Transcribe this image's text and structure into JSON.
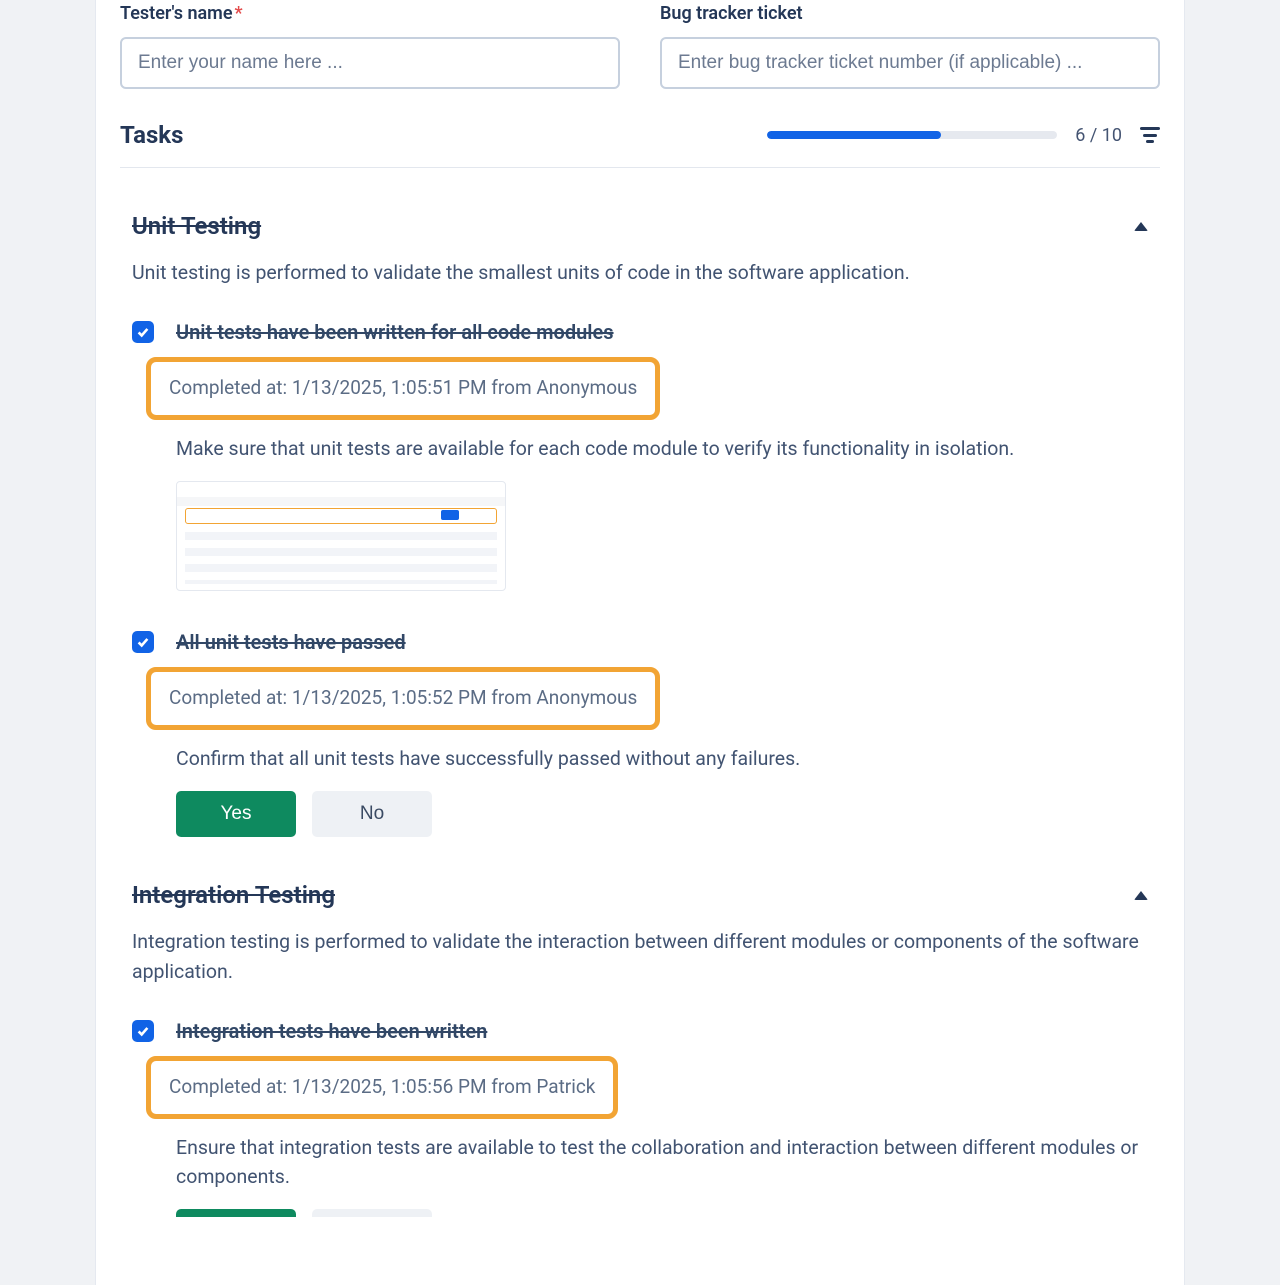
{
  "fields": {
    "tester_label": "Tester's name",
    "tester_required": "*",
    "tester_placeholder": "Enter your name here ...",
    "ticket_label": "Bug tracker ticket",
    "ticket_placeholder": "Enter bug tracker ticket number (if applicable) ..."
  },
  "tasks_header": {
    "title": "Tasks",
    "count_text": "6 / 10",
    "progress_percent": 60
  },
  "sections": [
    {
      "title": "Unit Testing",
      "description": "Unit testing is performed to validate the smallest units of code in the software application.",
      "tasks": [
        {
          "title": "Unit tests have been written for all code modules",
          "completed": "Completed at: 1/13/2025, 1:05:51 PM from Anonymous",
          "description": "Make sure that unit tests are available for each code module to verify its functionality in isolation.",
          "has_thumbnail": true
        },
        {
          "title": "All unit tests have passed",
          "completed": "Completed at: 1/13/2025, 1:05:52 PM from Anonymous",
          "description": "Confirm that all unit tests have successfully passed without any failures.",
          "buttons": {
            "yes": "Yes",
            "no": "No"
          }
        }
      ]
    },
    {
      "title": "Integration Testing",
      "description": "Integration testing is performed to validate the interaction between different modules or components of the software application.",
      "tasks": [
        {
          "title": "Integration tests have been written",
          "completed": "Completed at: 1/13/2025, 1:05:56 PM from Patrick",
          "description": "Ensure that integration tests are available to test the collaboration and interaction between different modules or components."
        }
      ]
    }
  ]
}
